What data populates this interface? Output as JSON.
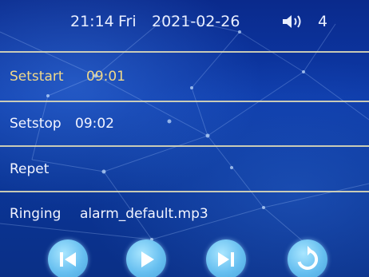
{
  "status": {
    "time": "21:14",
    "day": "Fri",
    "date": "2021-02-26",
    "volume": "4"
  },
  "menu": {
    "setstart": {
      "label": "Setstart",
      "value": "09:01"
    },
    "setstop": {
      "label": "Setstop",
      "value": "09:02"
    },
    "repeat": {
      "label": "Repet"
    },
    "ringing": {
      "label": "Ringing",
      "value": "alarm_default.mp3"
    }
  },
  "colors": {
    "background": "#0b3699",
    "selected_text": "#f0d98a",
    "divider": "#e9e3b8",
    "control_button": "#67bff0"
  },
  "icons": [
    "speaker-icon",
    "previous-icon",
    "play-icon",
    "next-icon",
    "repeat-icon"
  ]
}
